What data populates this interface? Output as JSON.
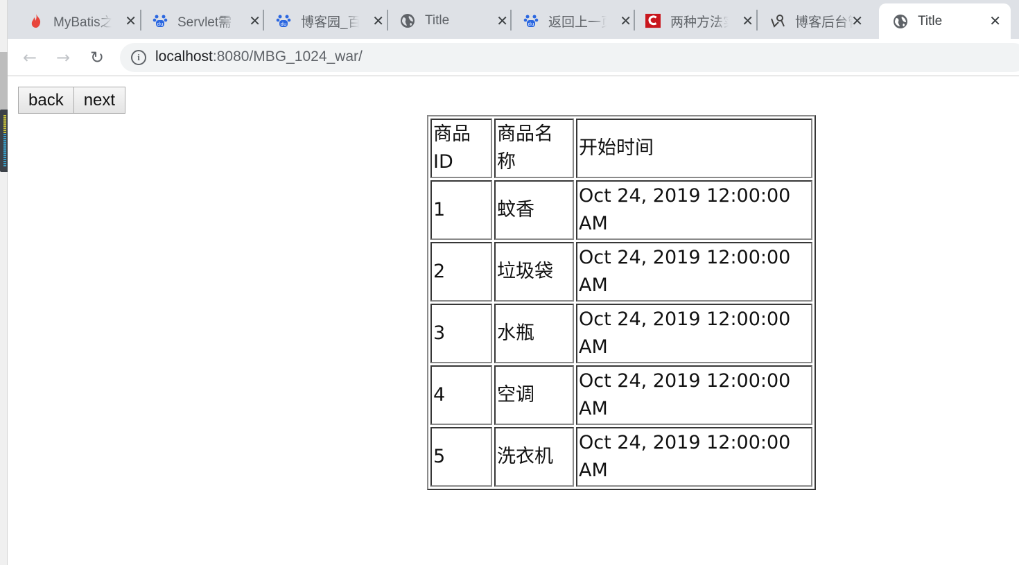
{
  "browser": {
    "tabs": [
      {
        "icon": "flame-icon",
        "label": "MyBatis之",
        "active": false
      },
      {
        "icon": "baidu-paw-icon",
        "label": "Servlet需",
        "active": false
      },
      {
        "icon": "baidu-paw-icon",
        "label": "博客园_百",
        "active": false
      },
      {
        "icon": "globe-icon",
        "label": "Title",
        "active": false
      },
      {
        "icon": "baidu-paw-icon",
        "label": "返回上一页",
        "active": false
      },
      {
        "icon": "csdn-c-icon",
        "label": "两种方法实",
        "active": false
      },
      {
        "icon": "cnblogs-icon",
        "label": "博客后台管",
        "active": false
      },
      {
        "icon": "globe-icon",
        "label": "Title",
        "active": true
      }
    ],
    "address_bar": {
      "host": "localhost",
      "rest": ":8080/MBG_1024_war/"
    },
    "colors": {
      "tabstrip_bg": "#dee1e6",
      "omnibox_bg": "#f1f3f4",
      "csdn_red": "#c9171e",
      "baidu_blue": "#2b67e0",
      "flame_red": "#e8453c"
    }
  },
  "page": {
    "buttons": {
      "back_label": "back",
      "next_label": "next"
    },
    "table": {
      "headers": [
        "商品ID",
        "商品名称",
        "开始时间"
      ],
      "rows": [
        {
          "id": "1",
          "name": "蚊香",
          "start_time": "Oct 24, 2019 12:00:00 AM"
        },
        {
          "id": "2",
          "name": "垃圾袋",
          "start_time": "Oct 24, 2019 12:00:00 AM"
        },
        {
          "id": "3",
          "name": "水瓶",
          "start_time": "Oct 24, 2019 12:00:00 AM"
        },
        {
          "id": "4",
          "name": "空调",
          "start_time": "Oct 24, 2019 12:00:00 AM"
        },
        {
          "id": "5",
          "name": "洗衣机",
          "start_time": "Oct 24, 2019 12:00:00 AM"
        }
      ]
    }
  }
}
